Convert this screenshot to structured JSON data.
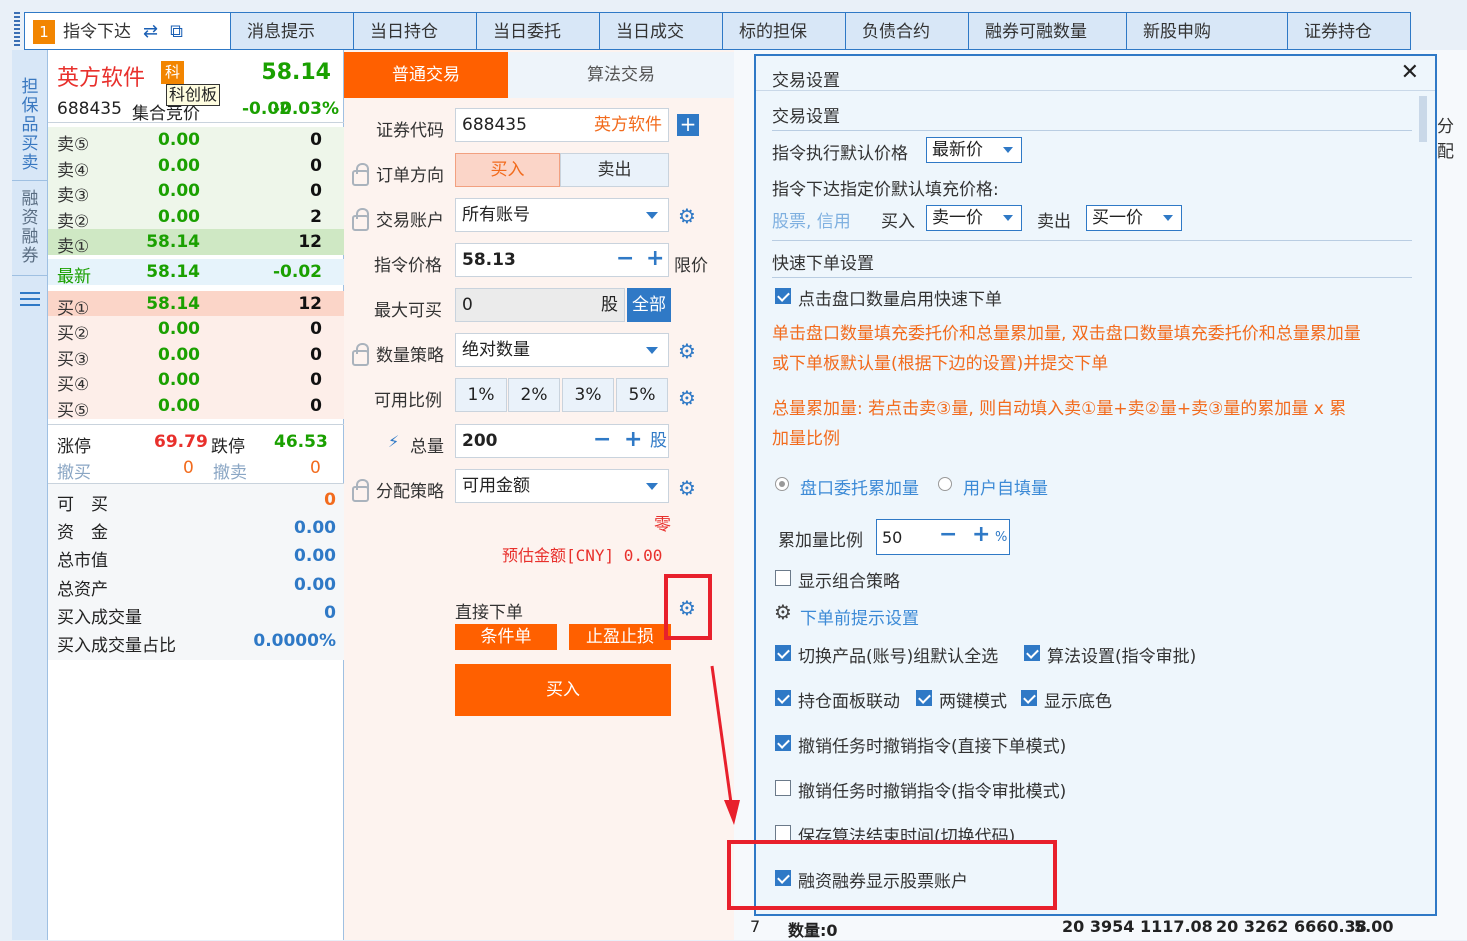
{
  "tabs": [
    {
      "num": "1",
      "label": "指令下达",
      "active": true
    },
    {
      "label": "消息提示"
    },
    {
      "label": "当日持仓"
    },
    {
      "label": "当日委托"
    },
    {
      "label": "当日成交"
    },
    {
      "label": "标的担保"
    },
    {
      "label": "负债合约"
    },
    {
      "label": "融券可融数量"
    },
    {
      "label": "新股申购"
    },
    {
      "label": "证券持仓"
    }
  ],
  "side": {
    "tab1": "担保品买卖",
    "tab2": "融资融券"
  },
  "quote": {
    "name": "英方软件",
    "board_badge": "科",
    "board_tooltip": "科创板",
    "price": "58.14",
    "code": "688435",
    "market": "集合竞价",
    "change": "-0.02",
    "change_pct": "-0.03%",
    "sells": [
      {
        "label": "卖⑤",
        "price": "0.00",
        "vol": "0"
      },
      {
        "label": "卖④",
        "price": "0.00",
        "vol": "0"
      },
      {
        "label": "卖③",
        "price": "0.00",
        "vol": "0"
      },
      {
        "label": "卖②",
        "price": "0.00",
        "vol": "2"
      },
      {
        "label": "卖①",
        "price": "58.14",
        "vol": "12"
      }
    ],
    "latest": {
      "label": "最新",
      "price": "58.14",
      "vol": "-0.02"
    },
    "buys": [
      {
        "label": "买①",
        "price": "58.14",
        "vol": "12"
      },
      {
        "label": "买②",
        "price": "0.00",
        "vol": "0"
      },
      {
        "label": "买③",
        "price": "0.00",
        "vol": "0"
      },
      {
        "label": "买④",
        "price": "0.00",
        "vol": "0"
      },
      {
        "label": "买⑤",
        "price": "0.00",
        "vol": "0"
      }
    ],
    "limit_up_label": "涨停",
    "limit_up": "69.79",
    "limit_down_label": "跌停",
    "limit_down": "46.53",
    "cancel_buy_label": "撤买",
    "cancel_buy": "0",
    "cancel_sell_label": "撤卖",
    "cancel_sell": "0",
    "stats": [
      {
        "label": "可　买",
        "value": "0"
      },
      {
        "label": "资　金",
        "value": "0.00"
      },
      {
        "label": "总市值",
        "value": "0.00"
      },
      {
        "label": "总资产",
        "value": "0.00"
      },
      {
        "label": "买入成交量",
        "value": "0"
      },
      {
        "label": "买入成交量占比",
        "value": "0.0000%"
      }
    ]
  },
  "order": {
    "tab_normal": "普通交易",
    "tab_algo": "算法交易",
    "code_label": "证券代码",
    "code_value": "688435",
    "code_name": "英方软件",
    "direction_label": "订单方向",
    "buy": "买入",
    "sell": "卖出",
    "account_label": "交易账户",
    "account_value": "所有账号",
    "price_label": "指令价格",
    "price_value": "58.13",
    "price_type": "限价",
    "max_label": "最大可买",
    "max_value": "0",
    "max_unit": "股",
    "all_btn": "全部",
    "qty_strategy_label": "数量策略",
    "qty_strategy_value": "绝对数量",
    "ratio_label": "可用比例",
    "ratios": [
      "1%",
      "2%",
      "3%",
      "5%"
    ],
    "total_label": "总量",
    "total_value": "200",
    "total_unit": "股",
    "alloc_label": "分配策略",
    "alloc_value": "可用金额",
    "zero_text": "零",
    "estimate_text": "预估金额[CNY] 0.00",
    "direct_label": "直接下单",
    "cond_btn": "条件单",
    "stop_btn": "止盈止损",
    "submit_btn": "买入"
  },
  "right_bg": {
    "header_frag": "分配",
    "row_num": "7",
    "qty_text": "数量:0",
    "val1": "20 3954 1117.08",
    "val2": "20 3262 6660.38",
    "val3": "5.00"
  },
  "dialog": {
    "title": "交易设置",
    "sec1": "交易设置",
    "default_price_label": "指令执行默认价格",
    "default_price_value": "最新价",
    "fill_label": "指令下达指定价默认填充价格:",
    "fill_scope": "股票, 信用",
    "buy_label": "买入",
    "buy_value": "卖一价",
    "sell_label": "卖出",
    "sell_value": "买一价",
    "sec2": "快速下单设置",
    "quick_enable": "点击盘口数量启用快速下单",
    "quick_desc1": "单击盘口数量填充委托价和总量累加量, 双击盘口数量填充委托价和总量累加量",
    "quick_desc2": "或下单板默认量(根据下边的设置)并提交下单",
    "accum_desc1": "总量累加量: 若点击卖③量, 则自动填入卖①量+卖②量+卖③量的累加量 x 累",
    "accum_desc2": "加量比例",
    "radio1": "盘口委托累加量",
    "radio2": "用户自填量",
    "ratio_label": "累加量比例",
    "ratio_value": "50",
    "ratio_unit": "%",
    "show_combo": "显示组合策略",
    "pre_tip": "下单前提示设置",
    "opt_switch": "切换产品(账号)组默认全选",
    "opt_algo": "算法设置(指令审批)",
    "opt_link": "持仓面板联动",
    "opt_twokey": "两键模式",
    "opt_bg": "显示底色",
    "opt_cancel1": "撤销任务时撤销指令(直接下单模式)",
    "opt_cancel2": "撤销任务时撤销指令(指令审批模式)",
    "opt_save": "保存算法结束时间(切换代码)",
    "opt_margin": "融资融券显示股票账户"
  }
}
